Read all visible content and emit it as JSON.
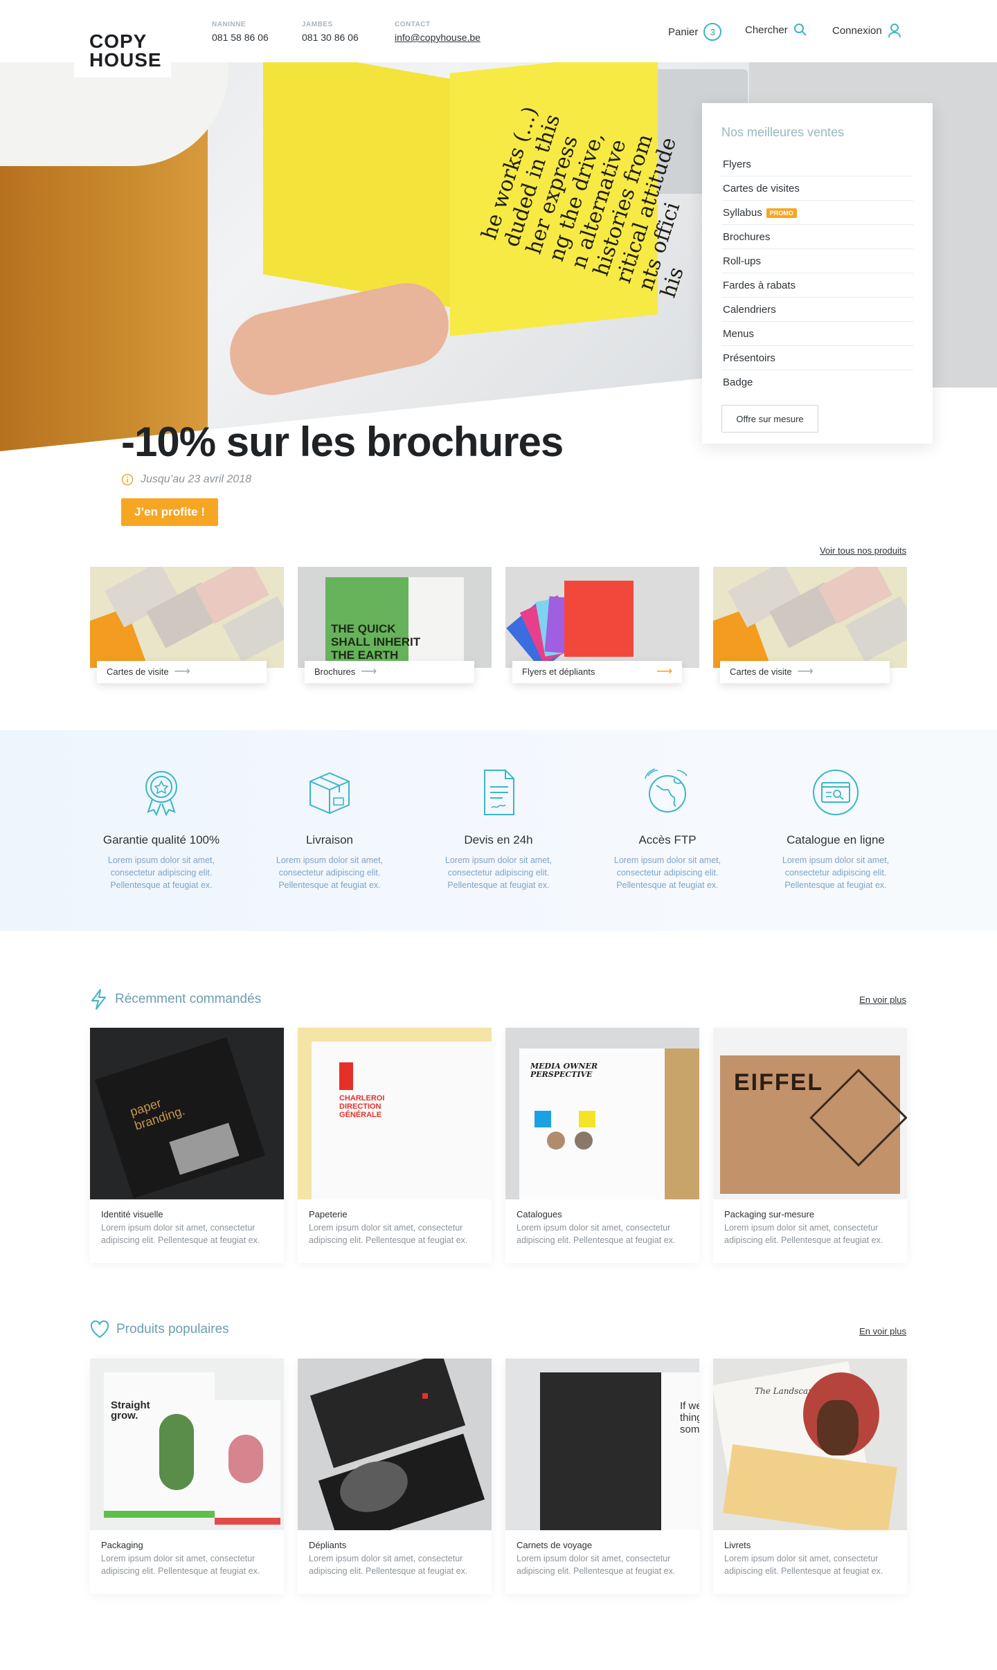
{
  "header": {
    "logo_line1": "COPY",
    "logo_line2": "HOUSE",
    "contacts": [
      {
        "label": "NANINNE",
        "value": "081 58 86 06"
      },
      {
        "label": "JAMBES",
        "value": "081 30 86 06"
      },
      {
        "label": "CONTACT",
        "value": "info@copyhouse.be"
      }
    ],
    "cart_label": "Panier",
    "cart_count": "3",
    "search_label": "Chercher",
    "login_label": "Connexion"
  },
  "hero": {
    "promo_title": "-10% sur les brochures",
    "promo_date": "Jusqu’au 23 avril 2018",
    "cta": "J’en profite !",
    "book_text": "he works (...)\nduded in this\nher express\nng the drive,\nn alternative\nhistories from\nritical attitude\nnts offici\nhis"
  },
  "bestsellers": {
    "title": "Nos meilleures ventes",
    "items": [
      "Flyers",
      "Cartes de visites",
      "Syllabus",
      "Brochures",
      "Roll-ups",
      "Fardes à rabats",
      "Calendriers",
      "Menus",
      "Présentoirs",
      "Badge"
    ],
    "promo_badge": "PROMO",
    "custom_button": "Offre sur mesure"
  },
  "products": {
    "see_all": "Voir tous nos produits",
    "categories": [
      {
        "label": "Cartes de visite"
      },
      {
        "label": "Brochures"
      },
      {
        "label": "Flyers et dépliants"
      },
      {
        "label": "Cartes de visite"
      }
    ]
  },
  "features": [
    {
      "icon": "award-icon",
      "title": "Garantie qualité 100%",
      "text": "Lorem ipsum dolor sit amet, consectetur adipiscing elit. Pellentesque at feugiat ex."
    },
    {
      "icon": "box-icon",
      "title": "Livraison",
      "text": "Lorem ipsum dolor sit amet, consectetur adipiscing elit. Pellentesque at feugiat ex."
    },
    {
      "icon": "document-icon",
      "title": "Devis en 24h",
      "text": "Lorem ipsum dolor sit amet, consectetur adipiscing elit. Pellentesque at feugiat ex."
    },
    {
      "icon": "globe-icon",
      "title": "Accès FTP",
      "text": "Lorem ipsum dolor sit amet, consectetur adipiscing elit. Pellentesque at feugiat ex."
    },
    {
      "icon": "browser-search-icon",
      "title": "Catalogue en ligne",
      "text": "Lorem ipsum dolor sit amet, consectetur adipiscing elit. Pellentesque at feugiat ex."
    }
  ],
  "recent": {
    "title": "Récemment commandés",
    "more": "En voir plus",
    "items": [
      {
        "title": "Identité visuelle",
        "text": "Lorem ipsum dolor sit amet, consectetur adipiscing elit. Pellentesque at feugiat ex.",
        "overlay": "paper\nbranding."
      },
      {
        "title": "Papeterie",
        "text": "Lorem ipsum dolor sit amet, consectetur adipiscing elit. Pellentesque at feugiat ex.",
        "overlay": "CHARLEROI\nDIRECTION\nGÉNÉRALE"
      },
      {
        "title": "Catalogues",
        "text": "Lorem ipsum dolor sit amet, consectetur adipiscing elit. Pellentesque at feugiat ex.",
        "overlay": "MEDIA OWNER\nPERSPECTIVE"
      },
      {
        "title": "Packaging sur-mesure",
        "text": "Lorem ipsum dolor sit amet, consectetur adipiscing elit. Pellentesque at feugiat ex.",
        "overlay": "EIFFEL"
      }
    ]
  },
  "popular": {
    "title": "Produits populaires",
    "more": "En voir plus",
    "items": [
      {
        "title": "Packaging",
        "text": "Lorem ipsum dolor sit amet, consectetur adipiscing elit. Pellentesque at feugiat ex.",
        "overlay": "Straight\ngrow."
      },
      {
        "title": "Dépliants",
        "text": "Lorem ipsum dolor sit amet, consectetur adipiscing elit. Pellentesque at feugiat ex.",
        "overlay": ""
      },
      {
        "title": "Carnets de voyage",
        "text": "Lorem ipsum dolor sit amet, consectetur adipiscing elit. Pellentesque at feugiat ex.",
        "overlay": "If we\nthing\nsom"
      },
      {
        "title": "Livrets",
        "text": "Lorem ipsum dolor sit amet, consectetur adipiscing elit. Pellentesque at feugiat ex.",
        "overlay": "The Landscape"
      }
    ]
  },
  "colors": {
    "accent": "#3bb6c4",
    "orange": "#f6a623",
    "heading_blue": "#6a9fb0",
    "feature_text": "#7fa3c4"
  }
}
